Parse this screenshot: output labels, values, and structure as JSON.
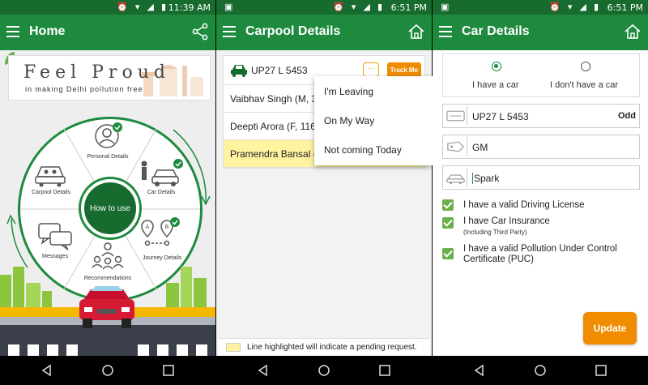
{
  "screen1": {
    "status_time": "11:39 AM",
    "title": "Home",
    "banner_big": "Feel Proud",
    "banner_small": "in making Delhi pollution free",
    "center_label": "How to use",
    "segments": {
      "personal": "Personal Details",
      "car": "Car Details",
      "journey": "Journey Details",
      "recommendations": "Recommendations",
      "messages": "Messages",
      "carpool": "Carpool Details"
    }
  },
  "screen2": {
    "status_time": "6:51 PM",
    "title": "Carpool Details",
    "plate": "UP27 L 5453",
    "track_label": "Track Me",
    "chat_glyph": "···",
    "members": [
      "Vaibhav Singh (M, 34",
      "Deepti Arora (F, 116)",
      "Pramendra Bansal (..."
    ],
    "menu": [
      "I'm Leaving",
      "On My Way",
      "Not coming Today"
    ],
    "legend": "Line highlighted will indicate a pending request."
  },
  "screen3": {
    "status_time": "6:51 PM",
    "title": "Car Details",
    "radio_have": "I have a car",
    "radio_dont": "I don't have a car",
    "plate": "UP27 L 5453",
    "odd": "Odd",
    "make": "GM",
    "model": "Spark",
    "checks": {
      "license": "I have a valid Driving License",
      "insurance": "I have Car Insurance",
      "insurance_sub": "(Including Third Party)",
      "puc": "I have a valid Pollution Under Control Certificate (PUC)"
    },
    "update_label": "Update"
  },
  "colors": {
    "primary": "#1e8a3e",
    "dark_primary": "#176b2e",
    "accent": "#f08c00",
    "highlight": "#fff3a0"
  }
}
